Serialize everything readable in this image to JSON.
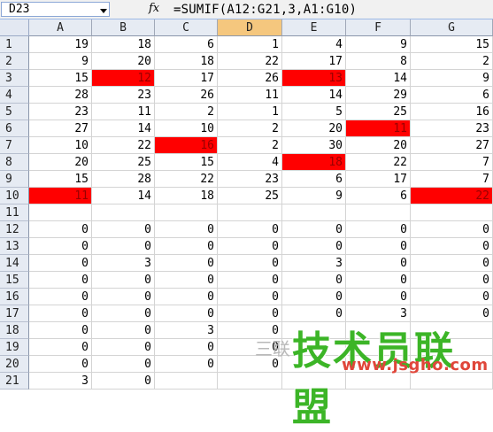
{
  "formula_bar": {
    "name_box": "D23",
    "fx_label": "fx",
    "formula": "=SUMIF(A12:G21,3,A1:G10)"
  },
  "columns": [
    "A",
    "B",
    "C",
    "D",
    "E",
    "F",
    "G"
  ],
  "active_column": "D",
  "rows": [
    {
      "num": "1",
      "cells": [
        "19",
        "18",
        "6",
        "1",
        "4",
        "9",
        "15"
      ]
    },
    {
      "num": "2",
      "cells": [
        "9",
        "20",
        "18",
        "22",
        "17",
        "8",
        "2"
      ]
    },
    {
      "num": "3",
      "cells": [
        "15",
        "12",
        "17",
        "26",
        "13",
        "14",
        "9"
      ]
    },
    {
      "num": "4",
      "cells": [
        "28",
        "23",
        "26",
        "11",
        "14",
        "29",
        "6"
      ]
    },
    {
      "num": "5",
      "cells": [
        "23",
        "11",
        "2",
        "1",
        "5",
        "25",
        "16"
      ]
    },
    {
      "num": "6",
      "cells": [
        "27",
        "14",
        "10",
        "2",
        "20",
        "11",
        "23"
      ]
    },
    {
      "num": "7",
      "cells": [
        "10",
        "22",
        "16",
        "2",
        "30",
        "20",
        "27"
      ]
    },
    {
      "num": "8",
      "cells": [
        "20",
        "25",
        "15",
        "4",
        "18",
        "22",
        "7"
      ]
    },
    {
      "num": "9",
      "cells": [
        "15",
        "28",
        "22",
        "23",
        "6",
        "17",
        "7"
      ]
    },
    {
      "num": "10",
      "cells": [
        "11",
        "14",
        "18",
        "25",
        "9",
        "6",
        "22"
      ]
    },
    {
      "num": "11",
      "cells": [
        "",
        "",
        "",
        "",
        "",
        "",
        ""
      ]
    },
    {
      "num": "12",
      "cells": [
        "0",
        "0",
        "0",
        "0",
        "0",
        "0",
        "0"
      ]
    },
    {
      "num": "13",
      "cells": [
        "0",
        "0",
        "0",
        "0",
        "0",
        "0",
        "0"
      ]
    },
    {
      "num": "14",
      "cells": [
        "0",
        "3",
        "0",
        "0",
        "3",
        "0",
        "0"
      ]
    },
    {
      "num": "15",
      "cells": [
        "0",
        "0",
        "0",
        "0",
        "0",
        "0",
        "0"
      ]
    },
    {
      "num": "16",
      "cells": [
        "0",
        "0",
        "0",
        "0",
        "0",
        "0",
        "0"
      ]
    },
    {
      "num": "17",
      "cells": [
        "0",
        "0",
        "0",
        "0",
        "0",
        "3",
        "0"
      ]
    },
    {
      "num": "18",
      "cells": [
        "0",
        "0",
        "3",
        "0",
        "",
        "",
        ""
      ]
    },
    {
      "num": "19",
      "cells": [
        "0",
        "0",
        "0",
        "0",
        "",
        "",
        ""
      ]
    },
    {
      "num": "20",
      "cells": [
        "0",
        "0",
        "0",
        "0",
        "",
        "",
        ""
      ]
    },
    {
      "num": "21",
      "cells": [
        "3",
        "0",
        "",
        "",
        "",
        "",
        ""
      ]
    }
  ],
  "highlighted": [
    {
      "row": 3,
      "col": 1
    },
    {
      "row": 3,
      "col": 4
    },
    {
      "row": 6,
      "col": 5
    },
    {
      "row": 7,
      "col": 2
    },
    {
      "row": 8,
      "col": 4
    },
    {
      "row": 10,
      "col": 0
    },
    {
      "row": 10,
      "col": 6
    }
  ],
  "highlight_color": "#ff0000",
  "watermark": {
    "brand": "技术员联盟",
    "url": "www.jsgho.com",
    "faint": "三联"
  }
}
